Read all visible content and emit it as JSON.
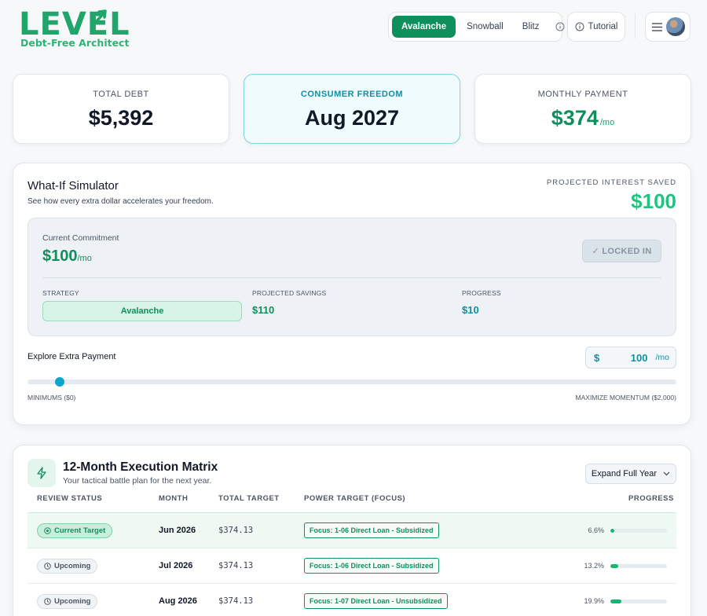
{
  "brand": {
    "name": "LEVEL",
    "tagline": "Debt-Free Architect"
  },
  "header": {
    "strategies": [
      "Avalanche",
      "Snowball",
      "Blitz"
    ],
    "active_strategy": "Avalanche",
    "tutorial_label": "Tutorial"
  },
  "stats": {
    "total_debt": {
      "label": "TOTAL DEBT",
      "value": "$5,392"
    },
    "freedom": {
      "label": "CONSUMER FREEDOM",
      "value": "Aug 2027"
    },
    "monthly": {
      "label": "MONTHLY PAYMENT",
      "value": "$374",
      "suffix": "/mo"
    }
  },
  "simulator": {
    "title": "What-If Simulator",
    "subtitle": "See how every extra dollar accelerates your freedom.",
    "saved_label": "PROJECTED INTEREST SAVED",
    "saved_value": "$100",
    "commitment_label": "Current Commitment",
    "commitment_value": "$100",
    "commitment_unit": "/mo",
    "locked_label": "✓ LOCKED IN",
    "strategy_label": "STRATEGY",
    "strategy_value": "Avalanche",
    "savings_label": "PROJECTED SAVINGS",
    "savings_value": "$110",
    "progress_label": "PROGRESS",
    "progress_value": "$10",
    "explore_label": "Explore Extra Payment",
    "input_currency": "$",
    "input_value": "100",
    "input_unit": "/mo",
    "slider_min_label": "MINIMUMS ($0)",
    "slider_max_label": "MAXIMIZE MOMENTUM ($2,000)",
    "slider_min": 0,
    "slider_max": 2000,
    "slider_value": 100
  },
  "matrix": {
    "title": "12-Month Execution Matrix",
    "subtitle": "Your tactical battle plan for the next year.",
    "expand_label": "Expand Full Year",
    "columns": [
      "REVIEW STATUS",
      "MONTH",
      "TOTAL TARGET",
      "POWER TARGET (FOCUS)",
      "PROGRESS"
    ],
    "rows": [
      {
        "status": "Current Target",
        "month": "Jun 2026",
        "total": "$374.13",
        "focus": "Focus: 1-06 Direct Loan - Subsidized",
        "pct": "6.6%",
        "progress": 0.066
      },
      {
        "status": "Upcoming",
        "month": "Jul 2026",
        "total": "$374.13",
        "focus": "Focus: 1-06 Direct Loan - Subsidized",
        "pct": "13.2%",
        "progress": 0.132
      },
      {
        "status": "Upcoming",
        "month": "Aug 2026",
        "total": "$374.13",
        "focus": "Focus: 1-07 Direct Loan - Unsubsidized",
        "pct": "19.9%",
        "progress": 0.199
      }
    ]
  },
  "colors": {
    "brand_green": "#0f8f5b",
    "accent_teal": "#0e8fa6",
    "mint": "#20c47f"
  }
}
